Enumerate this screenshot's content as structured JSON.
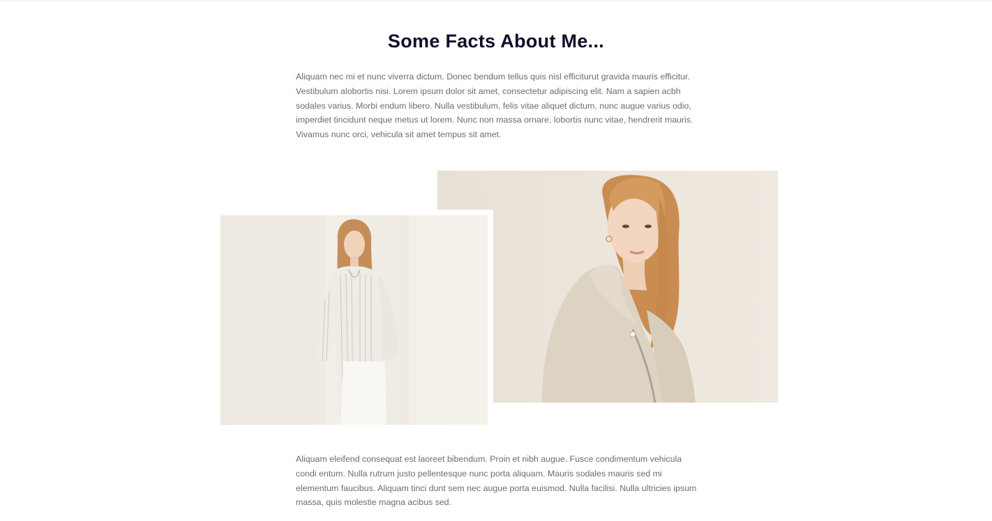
{
  "section": {
    "title": "Some Facts About Me...",
    "intro_text": "Aliquam nec mi et nunc viverra dictum. Donec bendum tellus quis nisl efficiturut gravida mauris efficitur. Vestibulum alobortis nisi. Lorem ipsum dolor sit amet, consectetur adipiscing elit. Nam a sapien acbh sodales varius. Morbi endum libero. Nulla vestibulum, felis vitae aliquet dictum, nunc augue varius odio, imperdiet tincidunt neque metus ut lorem. Nunc non massa ornare, lobortis nunc vitae, hendrerit mauris. Vivamus nunc orci, vehicula sit amet tempus sit amet.",
    "outro_text": "Aliquam eleifend consequat est laoreet bibendum. Proin et nibh augue. Fusce condimentum vehicula condi entum. Nulla rutrum justo pellentesque nunc porta aliquam. Mauris sodales mauris sed mi elementum faucibus. Aliquam tinci dunt sem nec augue porta euismod. Nulla facilisi. Nulla ultricies ipsum massa, quis molestie magna acibus sed."
  },
  "colors": {
    "title": "#0f0e2a",
    "body_text": "#6c6c72",
    "background": "#ffffff"
  }
}
